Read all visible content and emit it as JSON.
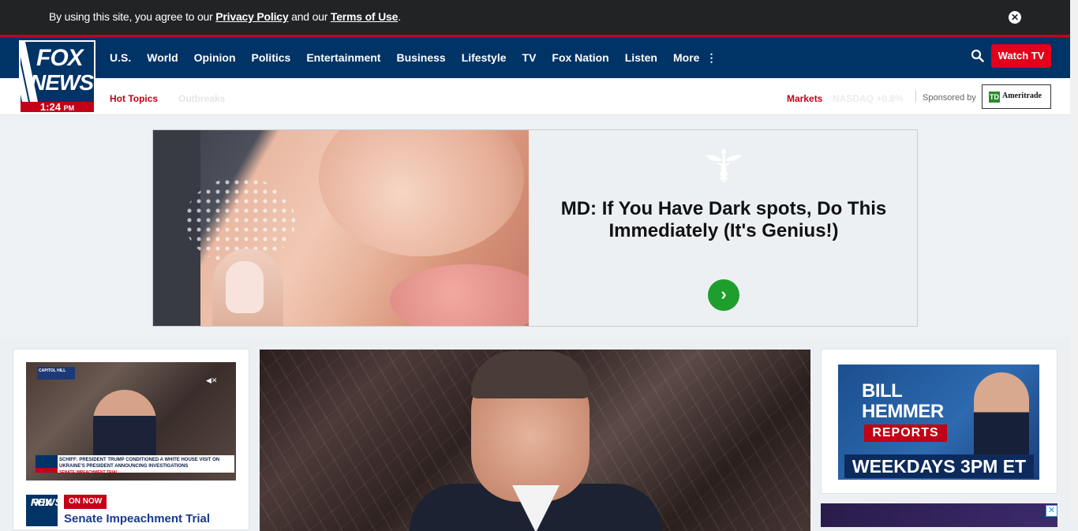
{
  "cookie_bar": {
    "text_prefix": "By using this site, you agree to our ",
    "privacy_link": "Privacy Policy",
    "text_mid": " and our ",
    "terms_link": "Terms of Use",
    "text_suffix": ".",
    "close_icon": "close-icon"
  },
  "logo": {
    "line1": "FOX",
    "line2": "NEWS",
    "time": "1:24",
    "ampm": "PM"
  },
  "nav": {
    "items": [
      "U.S.",
      "World",
      "Opinion",
      "Politics",
      "Entertainment",
      "Business",
      "Lifestyle",
      "TV",
      "Fox Nation",
      "Listen",
      "More"
    ],
    "more_icon": "vertical-dots-icon",
    "search_icon": "search-icon",
    "watch_tv": "Watch TV"
  },
  "subnav": {
    "hot_topics": "Hot Topics",
    "hot_topics_faded": "Outbreaks",
    "markets": "Markets",
    "markets_faded": "NASDAQ +0.8%",
    "sponsored_by": "Sponsored by",
    "sponsor_name": "Ameritrade",
    "sponsor_mark": "TD"
  },
  "ad": {
    "headline": "MD: If You Have Dark spots, Do This Immediately (It's Genius!)",
    "logo_icon": "caduceus-icon",
    "go_icon": "chevron-right-icon",
    "go_glyph": "›"
  },
  "left_card": {
    "video_tag": "CAPITOL HILL",
    "mute_icon": "mute-icon",
    "chyron": "SCHIFF: PRESIDENT TRUMP CONDITIONED A WHITE HOUSE VISIT ON UKRAINE'S PRESIDENT ANNOUNCING INVESTIGATIONS",
    "chyron_sub": "SENATE IMPEACHMENT TRIAL",
    "on_now": "ON NOW",
    "title": "Senate Impeachment Trial",
    "logo_line1": "FOX",
    "logo_line2": "NEWS"
  },
  "right_card": {
    "name1": "BILL",
    "name2": "HEMMER",
    "reports": "REPORTS",
    "schedule": "WEEKDAYS 3PM ET"
  },
  "adchoice": "✕",
  "colors": {
    "navy": "#003366",
    "red": "#c20017",
    "watch_red": "#e3001b",
    "link_blue": "#183a8f"
  }
}
